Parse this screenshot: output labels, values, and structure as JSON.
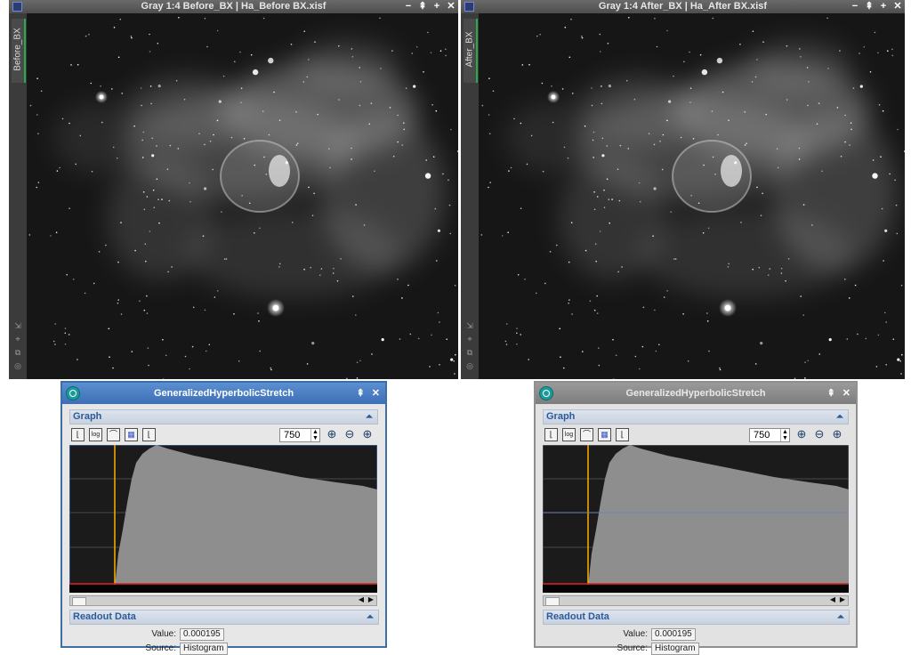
{
  "windows": [
    {
      "title": "Gray 1:4 Before_BX | Ha_Before BX.xisf",
      "view_tab": "Before_BX",
      "controls": [
        "−",
        "⇞",
        "+",
        "✕"
      ]
    },
    {
      "title": "Gray 1:4 After_BX | Ha_After BX.xisf",
      "view_tab": "After_BX",
      "controls": [
        "−",
        "⇞",
        "+",
        "✕"
      ]
    }
  ],
  "dialogs": [
    {
      "title": "GeneralizedHyperbolicStretch",
      "graph_section": "Graph",
      "zoom_value": "750",
      "readout_section": "Readout Data",
      "value_label": "Value:",
      "value": "0.000195",
      "source_label": "Source:",
      "source": "Histogram"
    },
    {
      "title": "GeneralizedHyperbolicStretch",
      "graph_section": "Graph",
      "zoom_value": "750",
      "readout_section": "Readout Data",
      "value_label": "Value:",
      "value": "0.000195",
      "source_label": "Source:",
      "source": "Histogram"
    }
  ],
  "icons": {
    "dialog_controls": [
      "⇞",
      "✕"
    ],
    "collapse": "⏶"
  },
  "colors": {
    "histogram_fill": "#8e8e8e",
    "graph_bg": "#1b1b1b",
    "marker": "#ffb000",
    "baseline": "#e02020",
    "titlebar_active": "#4a7bc2"
  }
}
